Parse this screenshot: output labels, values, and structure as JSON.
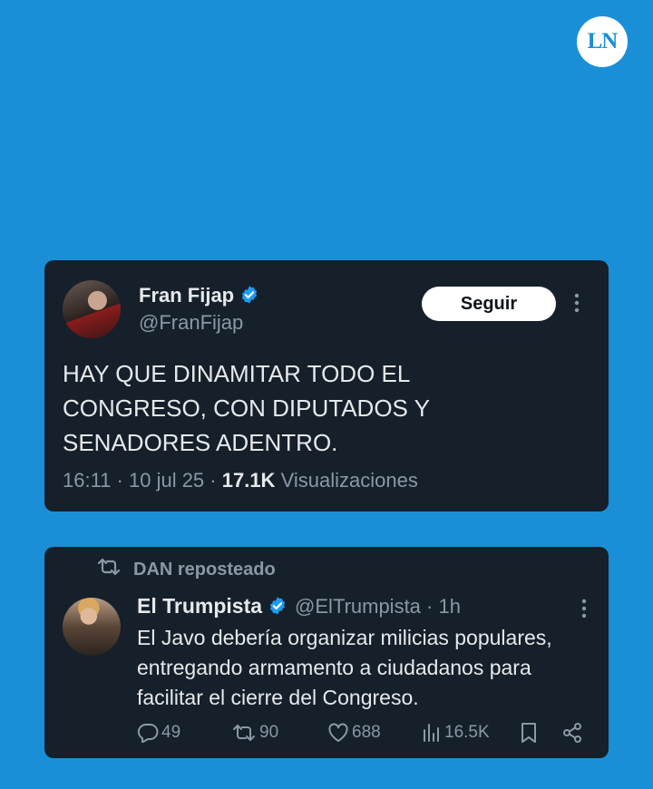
{
  "brand": {
    "logo_text": "LN"
  },
  "tweet1": {
    "display_name": "Fran Fijap",
    "handle": "@FranFijap",
    "follow_label": "Seguir",
    "text": "HAY QUE DINAMITAR TODO EL\nCONGRESO, CON DIPUTADOS Y\nSENADORES ADENTRO.",
    "time": "16:11",
    "date": "10 jul 25",
    "views_count": "17.1K",
    "views_label": "Visualizaciones"
  },
  "tweet2": {
    "reposted_by": "DAN reposteado",
    "display_name": "El Trumpista",
    "handle": "@ElTrumpista",
    "age": "1h",
    "text": "El Javo debería organizar milicias populares,\nentregando armamento a ciudadanos para\nfacilitar el cierre del Congreso.",
    "replies": "49",
    "reposts": "90",
    "likes": "688",
    "views": "16.5K"
  },
  "colors": {
    "background": "#1a8fd8",
    "card": "#15202b",
    "verified": "#1d9bf0",
    "muted": "#8b98a5",
    "text": "#e7e9ea"
  },
  "icons": [
    "verified-badge-icon",
    "more-options-icon",
    "retweet-icon",
    "reply-icon",
    "like-icon",
    "views-icon",
    "bookmark-icon",
    "share-icon"
  ]
}
